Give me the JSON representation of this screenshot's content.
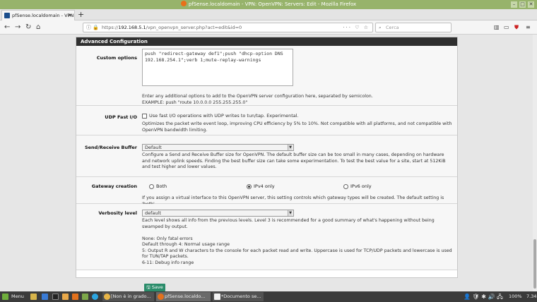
{
  "window": {
    "title": "pfSense.localdomain - VPN: OpenVPN: Servers: Edit - Mozilla Firefox"
  },
  "browser": {
    "tab_label": "pfSense.localdomain - VPN: O",
    "new_tab": "+",
    "url_prefix": "https://",
    "url_host": "192.168.5.1",
    "url_path": "/vpn_openvpn_server.php?act=edit&id=0",
    "url_actions": "··· ♡ ☆",
    "search_placeholder": "Cerca"
  },
  "section": {
    "title": "Advanced Configuration"
  },
  "custom_options": {
    "label": "Custom options",
    "value": "push \"redirect-gateway def1\";push \"dhcp-option DNS 192.168.254.1\";verb 1;mute-replay-warnings",
    "help1": "Enter any additional options to add to the OpenVPN server configuration here, separated by semicolon.",
    "help2": "EXAMPLE: push \"route 10.0.0.0 255.255.255.0\""
  },
  "udp_fast_io": {
    "label": "UDP Fast I/O",
    "checkbox_label": "Use fast I/O operations with UDP writes to tun/tap. Experimental.",
    "help": "Optimizes the packet write event loop, improving CPU efficiency by 5% to 10%. Not compatible with all platforms, and not compatible with OpenVPN bandwidth limiting."
  },
  "send_receive_buffer": {
    "label": "Send/Receive Buffer",
    "selected": "Default",
    "help": "Configure a Send and Receive Buffer size for OpenVPN. The default buffer size can be too small in many cases, depending on hardware and network uplink speeds. Finding the best buffer size can take some experimentation. To test the best value for a site, start at 512KiB and test higher and lower values."
  },
  "gateway_creation": {
    "label": "Gateway creation",
    "options": [
      "Both",
      "IPv4 only",
      "IPv6 only"
    ],
    "help": "If you assign a virtual interface to this OpenVPN server, this setting controls which gateway types will be created. The default setting is 'both'."
  },
  "verbosity_level": {
    "label": "Verbosity level",
    "selected": "default",
    "help": "Each level shows all info from the previous levels. Level 3 is recommended for a good summary of what's happening without being swamped by output.",
    "lines": [
      "None: Only fatal errors",
      "Default through 4: Normal usage range",
      "5: Output R and W characters to the console for each packet read and write. Uppercase is used for TCP/UDP packets and lowercase is used for TUN/TAP packets.",
      "6-11: Debug info range"
    ]
  },
  "save_label": "Save",
  "taskbar": {
    "menu": "Menu",
    "windows": [
      "[Non è in grado...",
      "pfSense.localdo...",
      "*Documento se..."
    ],
    "battery": "100%",
    "clock": "7.34"
  },
  "colors": {
    "titlebar": "#97b36b",
    "panel_header": "#2f2f2f",
    "save_button": "#2a8c6a"
  }
}
